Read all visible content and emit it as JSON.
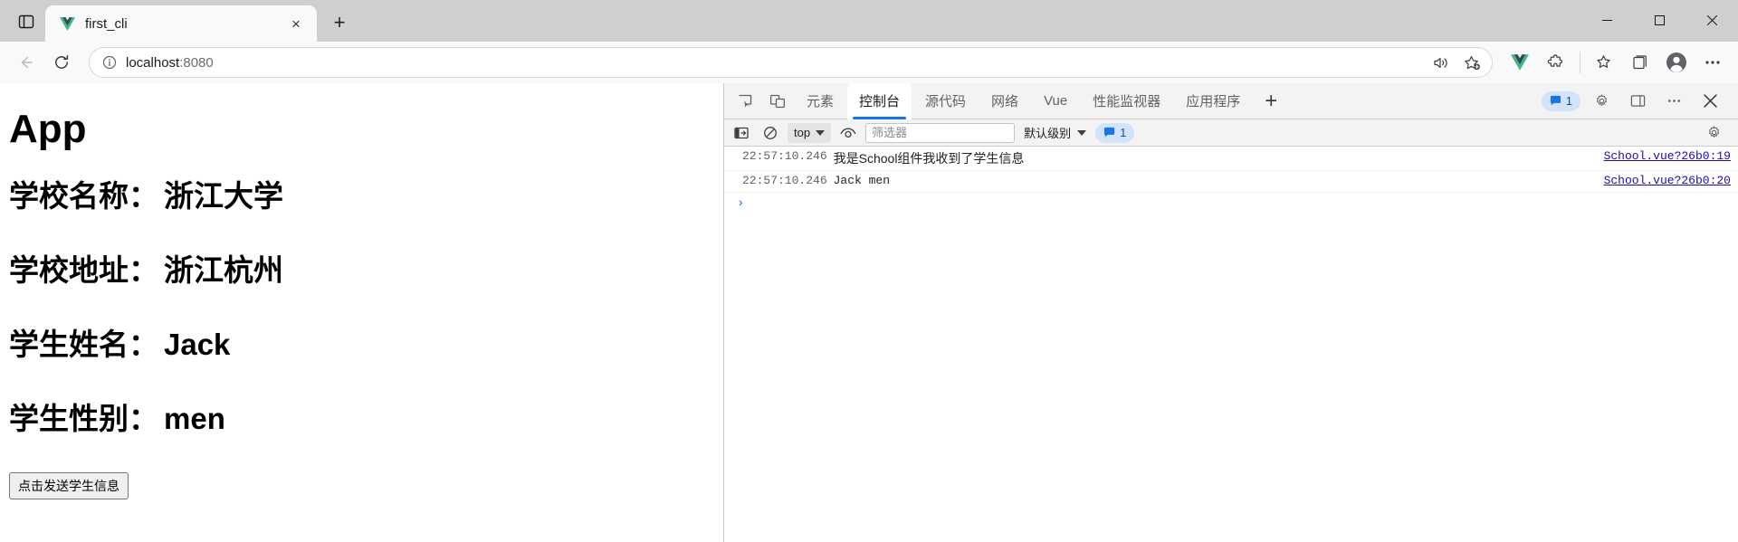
{
  "browser": {
    "tab": {
      "title": "first_cli",
      "favicon": "vue-logo-icon",
      "close_label": "×"
    },
    "new_tab_label": "+",
    "tab_search_icon": "tab-list-icon",
    "window_controls": {
      "minimize": "minimize-icon",
      "maximize": "maximize-icon",
      "close": "close-icon"
    },
    "nav": {
      "back_icon": "back-arrow-icon",
      "reload_icon": "reload-icon",
      "info_icon": "site-info-icon",
      "url_main": "localhost",
      "url_port": ":8080",
      "read_aloud_icon": "read-aloud-icon",
      "favorite_icon": "star-icon",
      "vue_devtools_icon": "vue-extension-icon",
      "extensions_icon": "extensions-puzzle-icon",
      "favorites_icon": "favorites-bar-icon",
      "collections_icon": "collections-icon",
      "profile_icon": "profile-avatar-icon",
      "settings_icon": "more-options-icon"
    }
  },
  "page": {
    "title": "App",
    "rows": [
      {
        "label": "学校名称：",
        "value": "浙江大学"
      },
      {
        "label": "学校地址：",
        "value": "浙江杭州"
      },
      {
        "label": "学生姓名：",
        "value": "Jack"
      },
      {
        "label": "学生性别：",
        "value": "men"
      }
    ],
    "button_label": "点击发送学生信息"
  },
  "devtools": {
    "inspect_icon": "inspect-element-icon",
    "device_icon": "device-toolbar-icon",
    "tabs": [
      {
        "label": "元素",
        "active": false
      },
      {
        "label": "控制台",
        "active": true
      },
      {
        "label": "源代码",
        "active": false
      },
      {
        "label": "网络",
        "active": false
      },
      {
        "label": "Vue",
        "active": false
      },
      {
        "label": "性能监视器",
        "active": false
      },
      {
        "label": "应用程序",
        "active": false
      }
    ],
    "more_tabs_label": "+",
    "message_badge": {
      "count": "1",
      "icon": "speech-bubble-icon"
    },
    "settings_icon": "gear-icon",
    "customize_icon": "dock-side-icon",
    "more_icon": "more-vertical-icon",
    "close_icon": "close-devtools-icon",
    "toolbar": {
      "sidebar_icon": "console-sidebar-icon",
      "clear_icon": "clear-console-icon",
      "context": "top",
      "eye_icon": "live-expression-icon",
      "filter_placeholder": "筛选器",
      "filter_value": "",
      "level": "默认级别",
      "issues": {
        "count": "1",
        "icon": "speech-bubble-icon"
      },
      "settings_icon": "gear-icon"
    },
    "logs": [
      {
        "timestamp": "22:57:10.246",
        "message": "我是School组件我收到了学生信息",
        "source": "School.vue?26b0:19",
        "mono": false
      },
      {
        "timestamp": "22:57:10.246",
        "message": "Jack men",
        "source": "School.vue?26b0:20",
        "mono": true
      }
    ],
    "prompt": "›"
  },
  "colors": {
    "accent": "#1a73e8",
    "link": "#1a0dab",
    "chrome_bg": "#cfcfcf",
    "toolbar_bg": "#f3f3f3"
  }
}
